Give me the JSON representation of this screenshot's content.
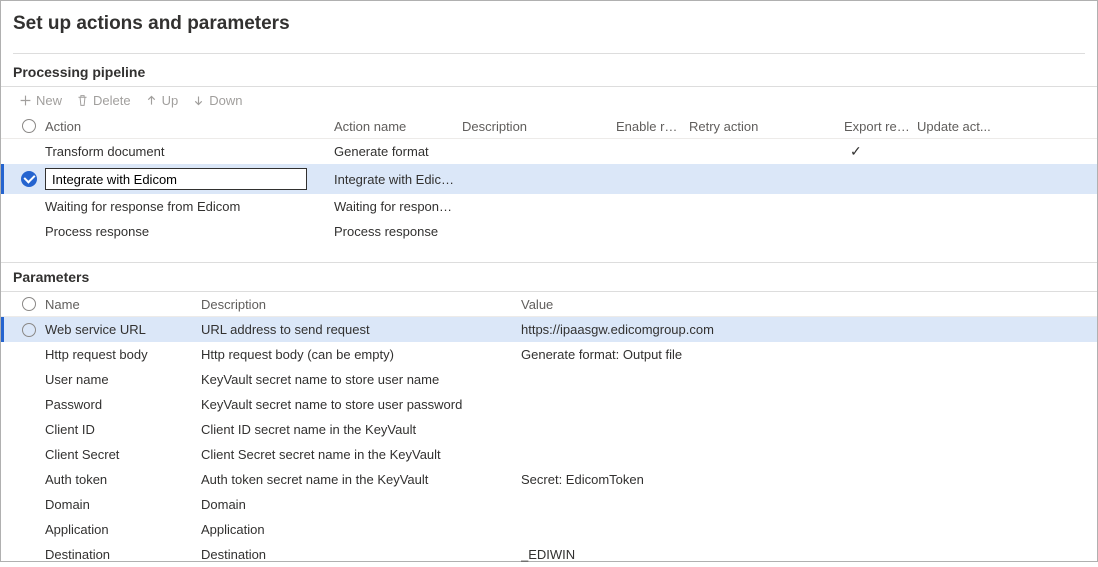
{
  "page": {
    "title": "Set up actions and parameters"
  },
  "sections": {
    "pipeline": "Processing pipeline",
    "parameters": "Parameters"
  },
  "toolbar": {
    "new": "New",
    "delete": "Delete",
    "up": "Up",
    "down": "Down"
  },
  "pipeline": {
    "headers": {
      "action": "Action",
      "action_name": "Action name",
      "description": "Description",
      "enable_retry": "Enable retry",
      "retry_action": "Retry action",
      "export_result": "Export result",
      "update_action": "Update act..."
    },
    "rows": [
      {
        "selected": false,
        "action": "Transform document",
        "action_name": "Generate format",
        "description": "",
        "enable_retry": "",
        "retry_action": "",
        "export_result": "✓",
        "update_action": ""
      },
      {
        "selected": true,
        "action": "Integrate with Edicom",
        "action_name": "Integrate with Edicom",
        "description": "",
        "enable_retry": "",
        "retry_action": "",
        "export_result": "",
        "update_action": ""
      },
      {
        "selected": false,
        "action": "Waiting for response from Edicom",
        "action_name": "Waiting for response fro...",
        "description": "",
        "enable_retry": "",
        "retry_action": "",
        "export_result": "",
        "update_action": ""
      },
      {
        "selected": false,
        "action": "Process response",
        "action_name": "Process response",
        "description": "",
        "enable_retry": "",
        "retry_action": "",
        "export_result": "",
        "update_action": ""
      }
    ]
  },
  "parameters": {
    "headers": {
      "name": "Name",
      "description": "Description",
      "value": "Value"
    },
    "rows": [
      {
        "selected": true,
        "name": "Web service URL",
        "description": "URL address to send request",
        "value": "https://ipaasgw.edicomgroup.com"
      },
      {
        "selected": false,
        "name": "Http request body",
        "description": "Http request body (can be empty)",
        "value": "Generate format: Output file"
      },
      {
        "selected": false,
        "name": "User name",
        "description": "KeyVault secret name to store user name",
        "value": ""
      },
      {
        "selected": false,
        "name": "Password",
        "description": "KeyVault secret name to store user password",
        "value": ""
      },
      {
        "selected": false,
        "name": "Client ID",
        "description": "Client ID secret name in the KeyVault",
        "value": ""
      },
      {
        "selected": false,
        "name": "Client Secret",
        "description": "Client Secret secret name in the KeyVault",
        "value": ""
      },
      {
        "selected": false,
        "name": "Auth token",
        "description": "Auth token secret name in the KeyVault",
        "value": "Secret:  EdicomToken"
      },
      {
        "selected": false,
        "name": "Domain",
        "description": "Domain",
        "value": ""
      },
      {
        "selected": false,
        "name": "Application",
        "description": "Application",
        "value": ""
      },
      {
        "selected": false,
        "name": "Destination",
        "description": "Destination",
        "value": "_EDIWIN"
      }
    ]
  }
}
